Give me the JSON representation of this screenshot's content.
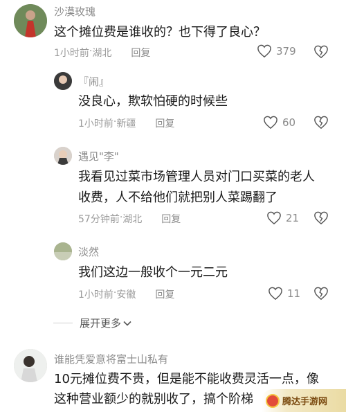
{
  "comments": [
    {
      "name": "沙漠玫瑰",
      "text_lines": [
        "这个摊位费是谁收的？也下得了良心？"
      ],
      "time": "1小时前",
      "location": "湖北",
      "reply": "回复",
      "likes": "379"
    },
    {
      "name": "『闹』",
      "text_lines": [
        "没良心，欺软怕硬的时候些"
      ],
      "time": "1小时前",
      "location": "新疆",
      "reply": "回复",
      "likes": "60"
    },
    {
      "name": "遇见\"李\"",
      "text_lines": [
        "我看见过菜市场管理人员对门口买菜的老人",
        "收费，人不给他们就把别人菜踢翻了"
      ],
      "time": "57分钟前",
      "location": "湖北",
      "reply": "回复",
      "likes": "21"
    },
    {
      "name": "淡然",
      "text_lines": [
        "我们这边一般收个一元二元"
      ],
      "time": "1小时前",
      "location": "安徽",
      "reply": "回复",
      "likes": "11"
    },
    {
      "name": "谁能凭爱意将富士山私有",
      "text_lines": [
        "10元摊位费不贵，但是能不能收费灵活一点，像",
        "这种营业额少的就别收了，搞个阶梯"
      ]
    }
  ],
  "expand_label": "展开更多",
  "meta_separator": " · ",
  "watermark_text": "腾达手游网",
  "icons": {
    "like": "heart-outline-icon",
    "dislike": "broken-heart-icon",
    "expand": "chevron-down-icon"
  }
}
